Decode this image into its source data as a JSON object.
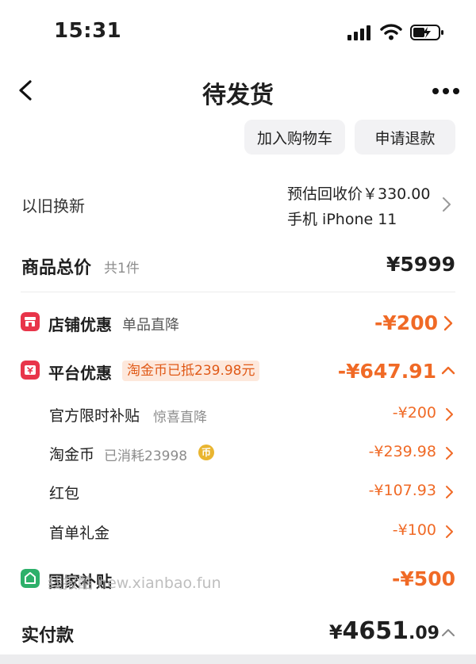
{
  "status_bar": {
    "time": "15:31"
  },
  "nav": {
    "title": "待发货"
  },
  "actions": {
    "add_to_cart": "加入购物车",
    "apply_refund": "申请退款"
  },
  "trade_in": {
    "label": "以旧换新",
    "estimate": "预估回收价￥330.00",
    "device": "手机 iPhone 11"
  },
  "goods_total": {
    "label": "商品总价",
    "count": "共1件",
    "price": "¥5999"
  },
  "shop_discount": {
    "label": "店铺优惠",
    "note": "单品直降",
    "amount": "-¥200"
  },
  "platform_discount": {
    "label": "平台优惠",
    "chip": "淘金币已抵239.98元",
    "amount": "-¥647.91",
    "items": [
      {
        "label": "官方限时补贴",
        "note": "惊喜直降",
        "amount": "-¥200"
      },
      {
        "label": "淘金币",
        "note": "已消耗23998",
        "badge": "币",
        "amount": "-¥239.98"
      },
      {
        "label": "红包",
        "note": "",
        "amount": "-¥107.93"
      },
      {
        "label": "首单礼金",
        "note": "",
        "amount": "-¥100"
      }
    ]
  },
  "national_subsidy": {
    "label": "国家补贴",
    "amount": "-¥500"
  },
  "watermark": "线报酷 new.xianbao.fun",
  "actual_payment": {
    "label": "实付款",
    "currency": "¥",
    "integer": "4651",
    "decimal": ".09"
  },
  "colors": {
    "accent_orange": "#f06a26",
    "shop_icon_red": "#e8354a",
    "subsidy_icon_green": "#2db06a",
    "coin_gold": "#e9b530"
  }
}
